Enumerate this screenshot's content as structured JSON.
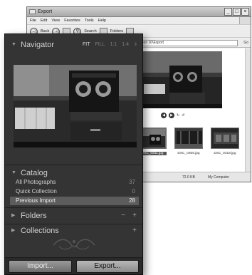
{
  "explorer": {
    "title": "Export",
    "menu": [
      "File",
      "Edit",
      "View",
      "Favorites",
      "Tools",
      "Help"
    ],
    "toolbar": {
      "back_label": "Back",
      "search_label": "Search",
      "folders_label": "Folders"
    },
    "address": "Lesson 10\\Export",
    "go_label": "Go",
    "preview_controls": [
      "◀",
      "▶"
    ],
    "thumbnails": [
      {
        "caption": "DSC_0311.jpg",
        "selected": true
      },
      {
        "caption": "DSC_0305.jpg",
        "selected": false
      },
      {
        "caption": "DSC_0318.jpg",
        "selected": false
      }
    ],
    "status": {
      "size": "72.0 KB",
      "location": "My Computer"
    }
  },
  "navigator": {
    "title": "Navigator",
    "zoom_options": [
      "FIT",
      "FILL",
      "1:1",
      "1:4"
    ],
    "active_zoom": "FIT",
    "zoom_dropdown_icon": "⇕"
  },
  "catalog": {
    "title": "Catalog",
    "items": [
      {
        "label": "All Photographs",
        "count": "37"
      },
      {
        "label": "Quick Collection",
        "count": "0"
      },
      {
        "label": "Previous Import",
        "count": "28"
      }
    ]
  },
  "folders": {
    "title": "Folders",
    "minus": "−",
    "plus": "+"
  },
  "collections": {
    "title": "Collections",
    "plus": "+"
  },
  "footer": {
    "import_label": "Import...",
    "export_label": "Export..."
  },
  "icons": {
    "expanded": "▼",
    "collapsed": "▶",
    "window_buttons": [
      "_",
      "□",
      "×"
    ]
  },
  "colors": {
    "panel_bg": "#343434",
    "selected_row": "#5c5c5c",
    "text": "#c9c9c9"
  }
}
